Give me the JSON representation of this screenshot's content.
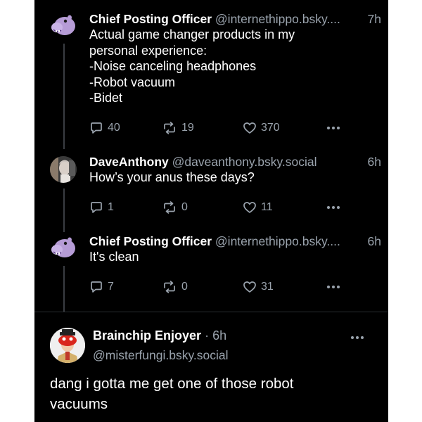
{
  "posts": [
    {
      "name": "Chief Posting Officer",
      "handle": "@internethippo.bsky....",
      "time": "7h",
      "lines": [
        "Actual game changer products in my",
        "personal experience:",
        "-Noise canceling headphones",
        "-Robot vacuum",
        "-Bidet"
      ],
      "replies": "40",
      "reposts": "19",
      "likes": "370"
    },
    {
      "name": "DaveAnthony",
      "handle": "@daveanthony.bsky.social",
      "time": "6h",
      "lines": [
        "How’s your anus these days?"
      ],
      "replies": "1",
      "reposts": "0",
      "likes": "11"
    },
    {
      "name": "Chief Posting Officer",
      "handle": "@internethippo.bsky....",
      "time": "6h",
      "lines": [
        "It's clean"
      ],
      "replies": "7",
      "reposts": "0",
      "likes": "31"
    }
  ],
  "focus_post": {
    "name": "Brainchip Enjoyer",
    "separator": "·",
    "time": "6h",
    "handle": "@misterfungi.bsky.social",
    "lines": [
      "dang i gotta me get one of those robot",
      "vacuums"
    ]
  },
  "colors": {
    "background": "#000000",
    "text": "#ffffff",
    "muted": "#9aa3ad",
    "hippo_avatar": "#b69cd6"
  },
  "icons": [
    "reply-icon",
    "repost-icon",
    "like-icon",
    "more-icon"
  ]
}
